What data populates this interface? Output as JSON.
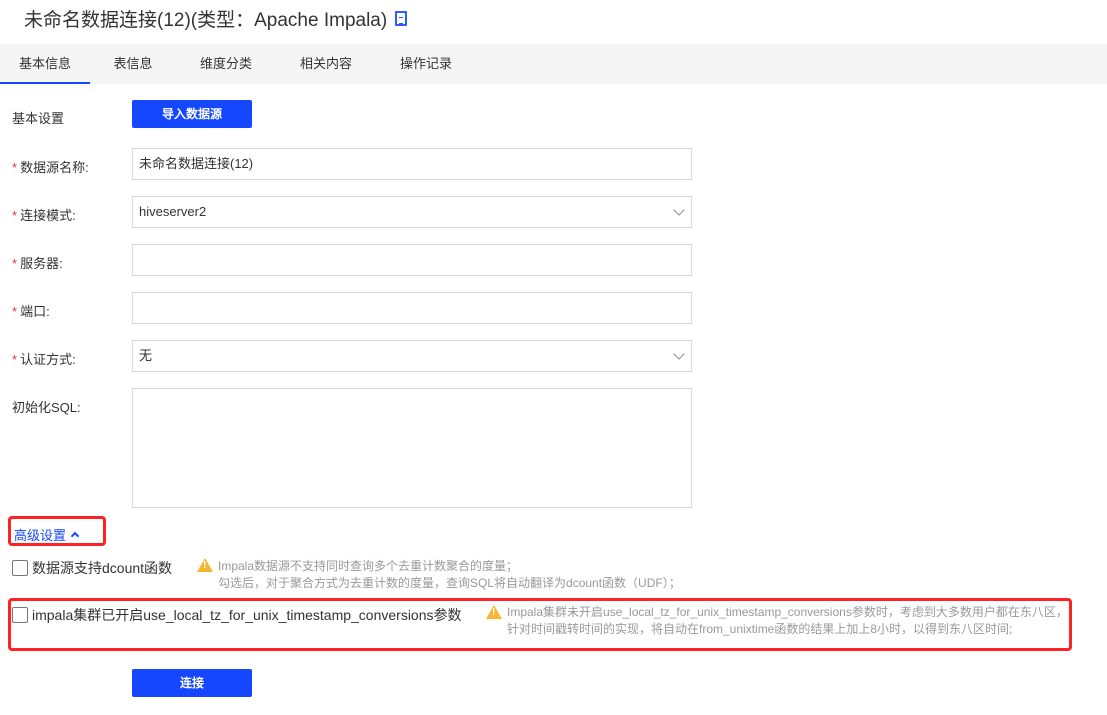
{
  "header": {
    "title": "未命名数据连接(12)(类型：Apache Impala)"
  },
  "tabs": [
    "基本信息",
    "表信息",
    "维度分类",
    "相关内容",
    "操作记录"
  ],
  "form": {
    "basic_settings_label": "基本设置",
    "import_button": "导入数据源",
    "name_label": "数据源名称:",
    "name_value": "未命名数据连接(12)",
    "mode_label": "连接模式:",
    "mode_value": "hiveserver2",
    "server_label": "服务器:",
    "server_value": "",
    "port_label": "端口:",
    "port_value": "",
    "auth_label": "认证方式:",
    "auth_value": "无",
    "sql_label": "初始化SQL:",
    "sql_value": "",
    "required_mark": "*"
  },
  "advanced": {
    "label": "高级设置",
    "dcount_label": "数据源支持dcount函数",
    "dcount_hint1": "Impala数据源不支持同时查询多个去重计数聚合的度量；",
    "dcount_hint2": "勾选后，对于聚合方式为去重计数的度量，查询SQL将自动翻译为dcount函数（UDF）；",
    "tz_label": "impala集群已开启use_local_tz_for_unix_timestamp_conversions参数",
    "tz_hint1": "Impala集群未开启use_local_tz_for_unix_timestamp_conversions参数时，考虑到大多数用户都在东八区，",
    "tz_hint2": "针对时间戳转时间的实现，将自动在from_unixtime函数的结果上加上8小时，以得到东八区时间;"
  },
  "connect_button": "连接"
}
